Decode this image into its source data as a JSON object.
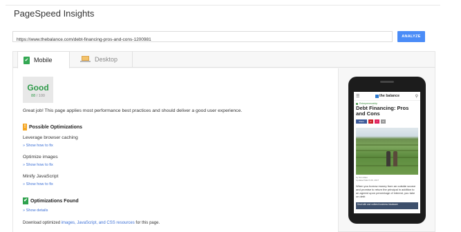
{
  "app": {
    "title": "PageSpeed Insights"
  },
  "url_bar": {
    "value": "https://www.thebalance.com/debt-financing-pros-and-cons-1200981",
    "button": "ANALYZE"
  },
  "tabs": [
    {
      "label": "Mobile",
      "active": true
    },
    {
      "label": "Desktop",
      "active": false
    }
  ],
  "score": {
    "label": "Good",
    "value": "88",
    "max": "/ 100"
  },
  "summary": "Great job! This page applies most performance best practices and should deliver a good user experience.",
  "possible": {
    "heading": "Possible Optimizations",
    "items": [
      {
        "text": "Leverage browser caching",
        "link": "» Show how to fix"
      },
      {
        "text": "Optimize images",
        "link": "» Show how to fix"
      },
      {
        "text": "Minify JavaScript",
        "link": "» Show how to fix"
      }
    ]
  },
  "found": {
    "heading": "Optimizations Found",
    "link": "» Show details"
  },
  "faded": {
    "prefix": "Download optimized ",
    "links": "images, JavaScript, and CSS resources",
    "suffix": " for this page."
  },
  "phone": {
    "logo": "the balance",
    "category": "Entrepreneurship",
    "title": "Debt Financing: Pros and Cons",
    "share": "Share",
    "meta_author": "by Tom Allen",
    "meta_date": "Updated March 09, 2017",
    "body": "When you borrow money from an outside source and promise to return the principal in addition to an agreed upon percentage of interest, you take on debt",
    "ad": "Deal with and outbest business bloatware"
  },
  "colors": {
    "accent": "#4a8cf7",
    "good": "#2e9a49",
    "warning": "#f5a623"
  }
}
